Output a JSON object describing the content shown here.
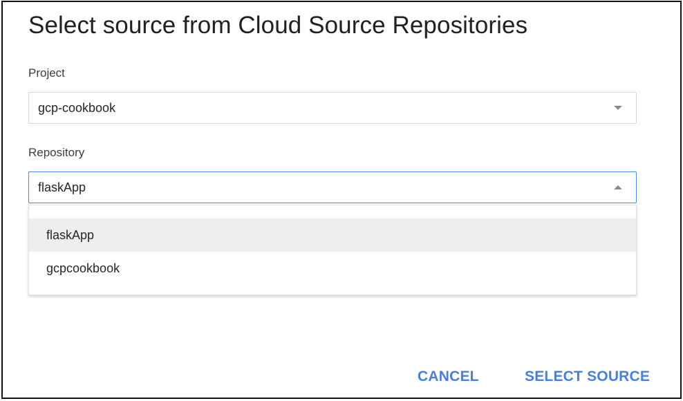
{
  "dialog": {
    "title": "Select source from Cloud Source Repositories"
  },
  "project": {
    "label": "Project",
    "value": "gcp-cookbook",
    "state": "collapsed",
    "icon": "chevron-down-icon"
  },
  "repository": {
    "label": "Repository",
    "value": "flaskApp",
    "state": "expanded",
    "icon": "chevron-up-icon",
    "options": [
      {
        "label": "flaskApp",
        "highlighted": true
      },
      {
        "label": "gcpcookbook",
        "highlighted": false
      }
    ]
  },
  "actions": {
    "cancel_label": "CANCEL",
    "select_label": "SELECT SOURCE"
  },
  "colors": {
    "accent": "#4a7fd6",
    "focus_border": "#4a86e8",
    "highlight_bg": "#eeeeee"
  }
}
